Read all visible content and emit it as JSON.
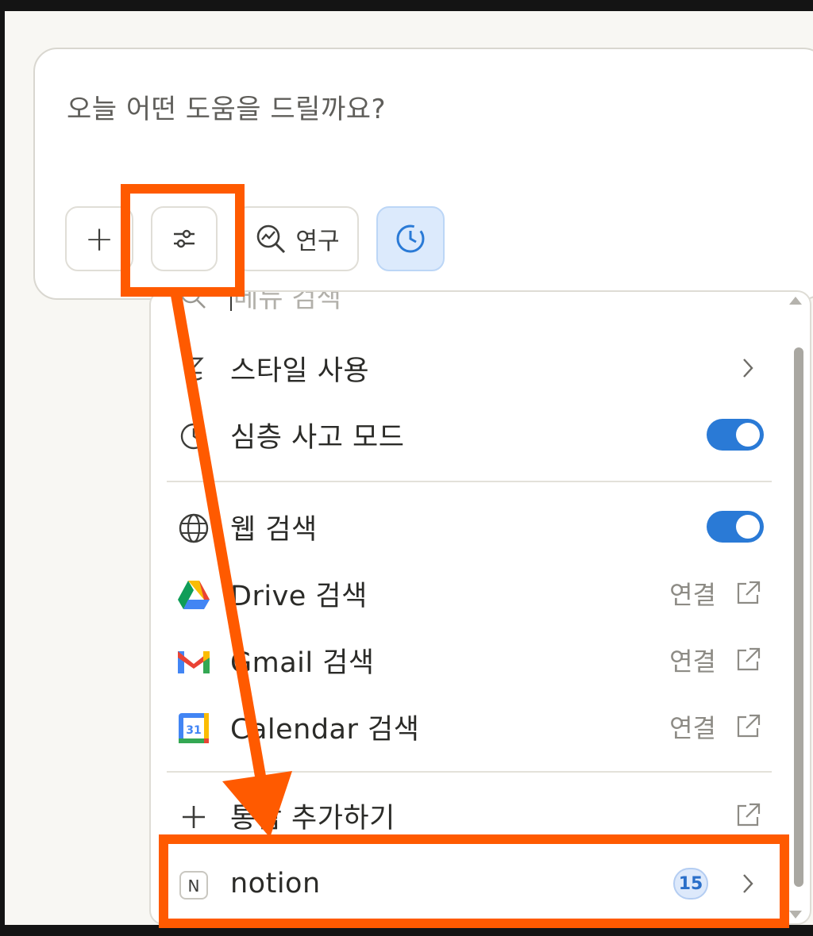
{
  "composer": {
    "placeholder": "오늘 어떤 도움을 드릴까요?",
    "research_label": "연구"
  },
  "menu": {
    "search_placeholder": "메뉴 검색",
    "items": [
      {
        "label": "스타일 사용",
        "icon": "style-icon",
        "trailing": "chevron"
      },
      {
        "label": "심층 사고 모드",
        "icon": "deep-thinking-icon",
        "trailing": "toggle",
        "on": true
      },
      {
        "label": "웹 검색",
        "icon": "globe-icon",
        "trailing": "toggle",
        "on": true
      },
      {
        "label": "Drive 검색",
        "icon": "google-drive-icon",
        "link": "연결"
      },
      {
        "label": "Gmail 검색",
        "icon": "gmail-icon",
        "link": "연결"
      },
      {
        "label": "Calendar 검색",
        "icon": "google-calendar-icon",
        "link": "연결",
        "icon_text": "31"
      },
      {
        "label": "통합 추가하기",
        "icon": "plus-icon"
      },
      {
        "label": "notion",
        "icon": "notion-icon",
        "icon_text": "N",
        "badge": "15"
      }
    ]
  },
  "colors": {
    "accent_blue": "#2a7ad6",
    "annotation_orange": "#ff5a00"
  }
}
